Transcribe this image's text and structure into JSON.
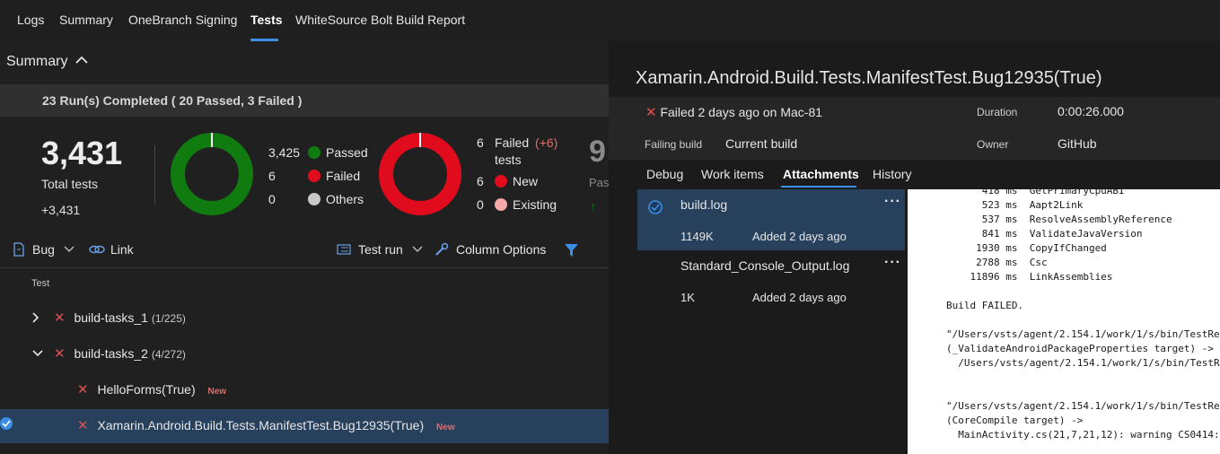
{
  "top_tabs": [
    "Logs",
    "Summary",
    "OneBranch Signing",
    "Tests",
    "WhiteSource Bolt Build Report"
  ],
  "summary": {
    "header": "Summary",
    "runs_completed": "23 Run(s) Completed ( 20 Passed, 3 Failed )",
    "total_tests": "3,431",
    "total_tests_label": "Total tests",
    "total_delta": "+3,431",
    "outcome_legend": [
      {
        "count": "3,425",
        "label": "Passed",
        "color": "#107c10"
      },
      {
        "count": "6",
        "label": "Failed",
        "color": "#e00b1c"
      },
      {
        "count": "0",
        "label": "Others",
        "color": "#c8c8c8"
      }
    ],
    "failed_tests": {
      "count": "6",
      "label": "Failed",
      "delta": "(+6)",
      "sublabel": "tests",
      "legend": [
        {
          "count": "6",
          "label": "New",
          "color": "#e00b1c"
        },
        {
          "count": "0",
          "label": "Existing",
          "color": "#f4a9a9"
        }
      ]
    },
    "partial_number": "9",
    "partial_label": "Pas"
  },
  "toolbar": {
    "bug": "Bug",
    "link": "Link",
    "test_run": "Test run",
    "column_options": "Column Options"
  },
  "column_header": "Test",
  "tree": [
    {
      "name": "build-tasks_1",
      "count": "(1/225)"
    },
    {
      "name": "build-tasks_2",
      "count": "(4/272)"
    },
    {
      "name": "HelloForms(True)",
      "tag": "New"
    },
    {
      "name": "Xamarin.Android.Build.Tests.ManifestTest.Bug12935(True)",
      "tag": "New"
    }
  ],
  "detail": {
    "title": "Xamarin.Android.Build.Tests.ManifestTest.Bug12935(True)",
    "status": "Failed 2 days ago on Mac-81",
    "duration_label": "Duration",
    "duration_value": "0:00:26.000",
    "failing_build_label": "Failing build",
    "failing_build_value": "Current build",
    "owner_label": "Owner",
    "owner_value": "GitHub",
    "tabs": [
      "Debug",
      "Work items",
      "Attachments",
      "History"
    ],
    "attachments": [
      {
        "name": "build.log",
        "size": "1149K",
        "added": "Added 2 days ago"
      },
      {
        "name": "Standard_Console_Output.log",
        "size": "1K",
        "added": "Added 2 days ago"
      }
    ],
    "log_text": "      418 ms  GetPrimaryCpuABI\n      523 ms  Aapt2Link\n      537 ms  ResolveAssemblyReference\n      841 ms  ValidateJavaVersion\n     1930 ms  CopyIfChanged\n     2788 ms  Csc\n    11896 ms  LinkAssemblies\n\nBuild FAILED.\n\n\"/Users/vsts/agent/2.154.1/work/1/s/bin/TestRe\n(_ValidateAndroidPackageProperties target) ->\n  /Users/vsts/agent/2.154.1/work/1/s/bin/TestRe\n\n\n\"/Users/vsts/agent/2.154.1/work/1/s/bin/TestRe\n(CoreCompile target) ->\n  MainActivity.cs(21,7,21,12): warning CS0414:"
  },
  "colors": {
    "accent": "#3a8ee6",
    "passed": "#107c10",
    "failed": "#e00b1c",
    "selected_row": "#27405c"
  }
}
